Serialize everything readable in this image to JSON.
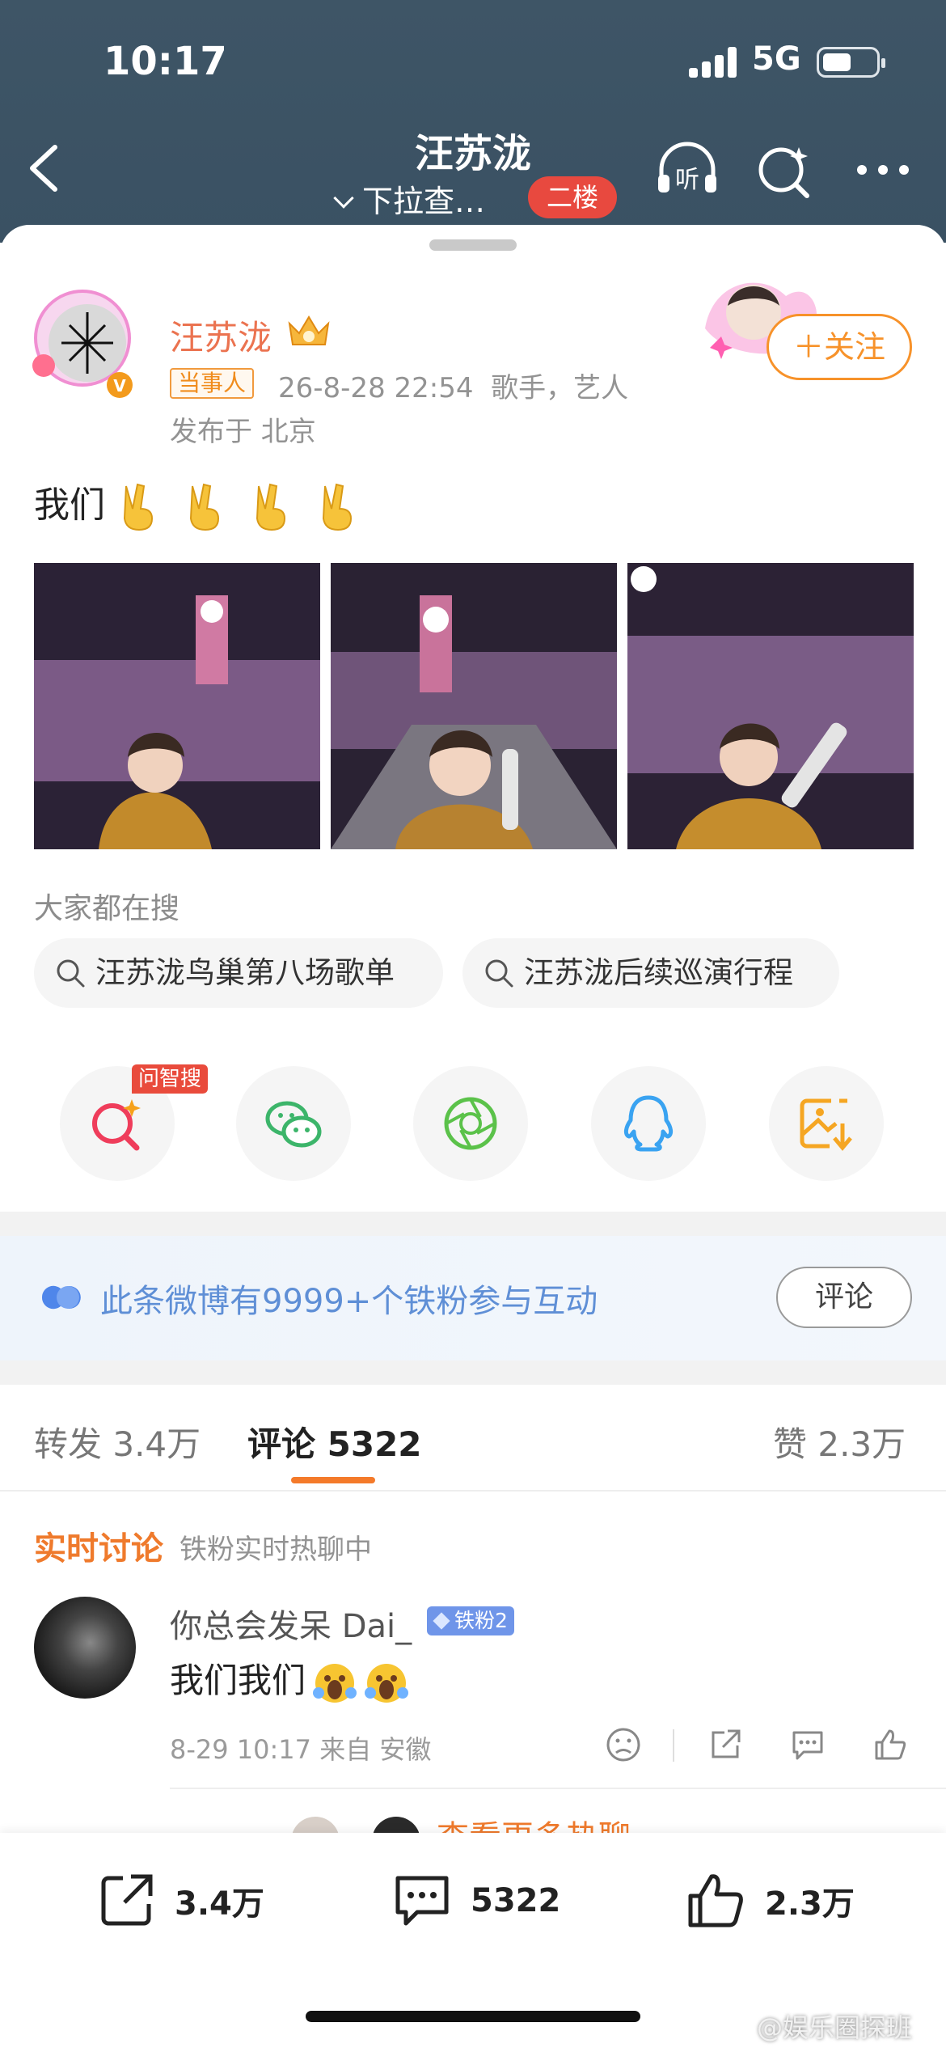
{
  "status_bar": {
    "time": "10:17",
    "network": "5G"
  },
  "nav": {
    "title": "汪苏泷",
    "subtitle": "下拉查…",
    "floor_badge": "二楼"
  },
  "post": {
    "author": "汪苏泷",
    "tag": "当事人",
    "datetime": "26-8-28 22:54",
    "identity": "歌手，艺人",
    "location": "发布于 北京",
    "follow_label": "关注",
    "text": "我们",
    "emoji_count": 4,
    "photos": [
      {
        "name": "photo-1",
        "color": "#6a4a7a"
      },
      {
        "name": "photo-2",
        "color": "#5d4a66"
      },
      {
        "name": "photo-3",
        "color": "#6b5272"
      }
    ]
  },
  "search": {
    "title": "大家都在搜",
    "chips": [
      "汪苏泷鸟巢第八场歌单",
      "汪苏泷后续巡演行程"
    ]
  },
  "share": {
    "ai_badge": "问智搜",
    "items": [
      {
        "icon": "ai-search-icon"
      },
      {
        "icon": "wechat-icon"
      },
      {
        "icon": "moments-icon"
      },
      {
        "icon": "qq-icon"
      },
      {
        "icon": "save-image-icon"
      }
    ]
  },
  "fans_bar": {
    "text": "此条微博有9999+个铁粉参与互动",
    "button": "评论"
  },
  "tabs": {
    "repost": "转发 3.4万",
    "comments": "评论 5322",
    "likes": "赞 2.3万"
  },
  "realtime": {
    "title": "实时讨论",
    "subtitle": "铁粉实时热聊中"
  },
  "comment": {
    "user": "你总会发呆 Dai_",
    "badge": "铁粉2",
    "text": "我们我们",
    "meta": "8-29 10:17 来自 安徽"
  },
  "peek_text": "查看更多热聊",
  "bottom_bar": {
    "repost": "3.4万",
    "comments": "5322",
    "likes": "2.3万"
  },
  "watermark": "@娱乐圈探班",
  "colors": {
    "header": "#3e5566",
    "accent": "#f7922a",
    "name": "#eb7350",
    "link_blue": "#5f8fd6"
  }
}
